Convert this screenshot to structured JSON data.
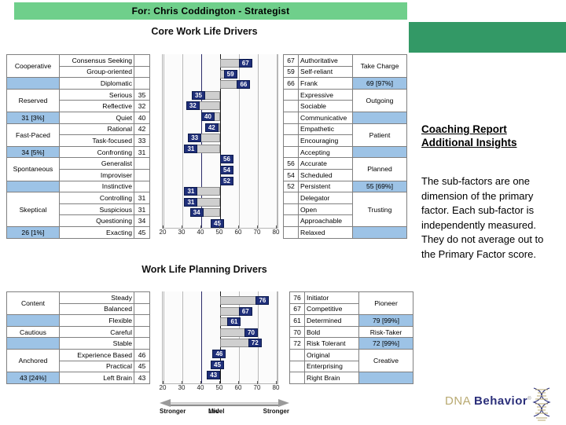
{
  "header": {
    "name_banner": "For: Chris Coddington - Strategist",
    "banner_color": "#6fcf8b",
    "green_block_color": "#339966"
  },
  "sections": {
    "core": {
      "title": "Core Work Life Drivers"
    },
    "planning": {
      "title": "Work Life Planning Drivers"
    }
  },
  "core_left": {
    "groups": [
      {
        "label": "Cooperative",
        "score": "",
        "subs": [
          {
            "name": "Consensus Seeking",
            "value": ""
          },
          {
            "name": "Group-oriented",
            "value": ""
          }
        ],
        "blue_label": "",
        "blue_sub": {
          "name": "Diplomatic",
          "value": ""
        }
      },
      {
        "label": "Reserved",
        "subs": [
          {
            "name": "Serious",
            "value": "35"
          },
          {
            "name": "Reflective",
            "value": "32"
          }
        ],
        "blue_label": "31 [3%]",
        "blue_sub": {
          "name": "Quiet",
          "value": "40"
        }
      },
      {
        "label": "Fast-Paced",
        "subs": [
          {
            "name": "Rational",
            "value": "42"
          },
          {
            "name": "Task-focused",
            "value": "33"
          }
        ],
        "blue_label": "34 [5%]",
        "blue_sub": {
          "name": "Confronting",
          "value": "31"
        }
      },
      {
        "label": "Spontaneous",
        "subs": [
          {
            "name": "Generalist",
            "value": ""
          },
          {
            "name": "Improviser",
            "value": ""
          }
        ],
        "blue_label": "",
        "blue_sub": {
          "name": "Instinctive",
          "value": ""
        }
      },
      {
        "label": "Skeptical",
        "subs": [
          {
            "name": "Controlling",
            "value": "31"
          },
          {
            "name": "Suspicious",
            "value": "31"
          },
          {
            "name": "Questioning",
            "value": "34"
          }
        ],
        "blue_label": "26 [1%]",
        "blue_sub": {
          "name": "Exacting",
          "value": "45"
        }
      }
    ]
  },
  "core_right": {
    "groups": [
      {
        "label": "Take Charge",
        "subs": [
          {
            "value": "67",
            "name": "Authoritative"
          },
          {
            "value": "59",
            "name": "Self-reliant"
          }
        ],
        "blue_label": "69 [97%]",
        "blue_sub": {
          "value": "66",
          "name": "Frank"
        }
      },
      {
        "label": "Outgoing",
        "subs": [
          {
            "value": "",
            "name": "Expressive"
          },
          {
            "value": "",
            "name": "Sociable"
          }
        ],
        "blue_label": "",
        "blue_sub": {
          "value": "",
          "name": "Communicative"
        }
      },
      {
        "label": "Patient",
        "subs": [
          {
            "value": "",
            "name": "Empathetic"
          },
          {
            "value": "",
            "name": "Encouraging"
          }
        ],
        "blue_label": "",
        "blue_sub": {
          "value": "",
          "name": "Accepting"
        }
      },
      {
        "label": "Planned",
        "subs": [
          {
            "value": "56",
            "name": "Accurate"
          },
          {
            "value": "54",
            "name": "Scheduled"
          }
        ],
        "blue_label": "55 [69%]",
        "blue_sub": {
          "value": "52",
          "name": "Persistent"
        }
      },
      {
        "label": "Trusting",
        "subs": [
          {
            "value": "",
            "name": "Delegator"
          },
          {
            "value": "",
            "name": "Open"
          },
          {
            "value": "",
            "name": "Approachable"
          }
        ],
        "blue_label": "",
        "blue_sub": {
          "value": "",
          "name": "Relaxed"
        }
      }
    ]
  },
  "plan_left": {
    "groups": [
      {
        "label": "Content",
        "subs": [
          {
            "name": "Steady",
            "value": ""
          },
          {
            "name": "Balanced",
            "value": ""
          }
        ],
        "blue_label": "",
        "blue_sub": {
          "name": "Flexible",
          "value": ""
        }
      },
      {
        "label": "Cautious",
        "subs": [
          {
            "name": "Careful",
            "value": ""
          }
        ],
        "blue_label": "",
        "blue_sub": {
          "name": "Stable",
          "value": ""
        }
      },
      {
        "label": "Anchored",
        "subs": [
          {
            "name": "Experience Based",
            "value": "46"
          },
          {
            "name": "Practical",
            "value": "45"
          }
        ],
        "blue_label": "43 [24%]",
        "blue_sub": {
          "name": "Left Brain",
          "value": "43"
        }
      }
    ]
  },
  "plan_right": {
    "groups": [
      {
        "label": "Pioneer",
        "subs": [
          {
            "value": "76",
            "name": "Initiator"
          },
          {
            "value": "67",
            "name": "Competitive"
          }
        ],
        "blue_label": "79 [99%]",
        "blue_sub": {
          "value": "61",
          "name": "Determined"
        }
      },
      {
        "label": "Risk-Taker",
        "subs": [
          {
            "value": "70",
            "name": "Bold"
          }
        ],
        "blue_label": "72 [99%]",
        "blue_sub": {
          "value": "72",
          "name": "Risk Tolerant"
        }
      },
      {
        "label": "Creative",
        "subs": [
          {
            "value": "",
            "name": "Original"
          },
          {
            "value": "",
            "name": "Enterprising"
          }
        ],
        "blue_label": "",
        "blue_sub": {
          "value": "",
          "name": "Right Brain"
        }
      }
    ]
  },
  "chart_data": [
    {
      "type": "bar",
      "title": "Core Work Life Drivers",
      "orientation": "horizontal",
      "xlabel": "",
      "ylabel": "",
      "xlim": [
        20,
        80
      ],
      "xticks": [
        20,
        30,
        40,
        50,
        60,
        70,
        80
      ],
      "grid": true,
      "center": 50,
      "categories": [
        "Authoritative",
        "Self-reliant",
        "Frank",
        "Serious",
        "Reflective",
        "Quiet",
        "Rational",
        "Task-focused",
        "Confronting",
        "Accurate",
        "Scheduled",
        "Persistent",
        "Controlling",
        "Suspicious",
        "Questioning",
        "Exacting"
      ],
      "values": [
        67,
        59,
        66,
        35,
        32,
        40,
        42,
        33,
        31,
        56,
        54,
        52,
        31,
        31,
        34,
        45
      ]
    },
    {
      "type": "bar",
      "title": "Work Life Planning Drivers",
      "orientation": "horizontal",
      "xlabel": "",
      "ylabel": "",
      "xlim": [
        20,
        80
      ],
      "xticks": [
        20,
        30,
        40,
        50,
        60,
        70,
        80
      ],
      "grid": true,
      "center": 50,
      "categories": [
        "Initiator",
        "Competitive",
        "Determined",
        "Bold",
        "Risk Tolerant",
        "Experience Based",
        "Practical",
        "Left Brain"
      ],
      "values": [
        76,
        67,
        61,
        70,
        72,
        46,
        45,
        43
      ]
    }
  ],
  "scale_legend": {
    "left": "Stronger",
    "mid_line1": "Mid-",
    "mid_line2": "Level",
    "right": "Stronger"
  },
  "insights": {
    "heading_line1": "Coaching Report",
    "heading_line2": "Additional Insights",
    "body": "The sub-factors are one dimension of the primary factor. Each sub-factor is independently measured. They do not average out to the Primary Factor score."
  },
  "logo": {
    "word1": "DNA ",
    "word2": "Behavior",
    "mark": "dna-helix-icon"
  }
}
